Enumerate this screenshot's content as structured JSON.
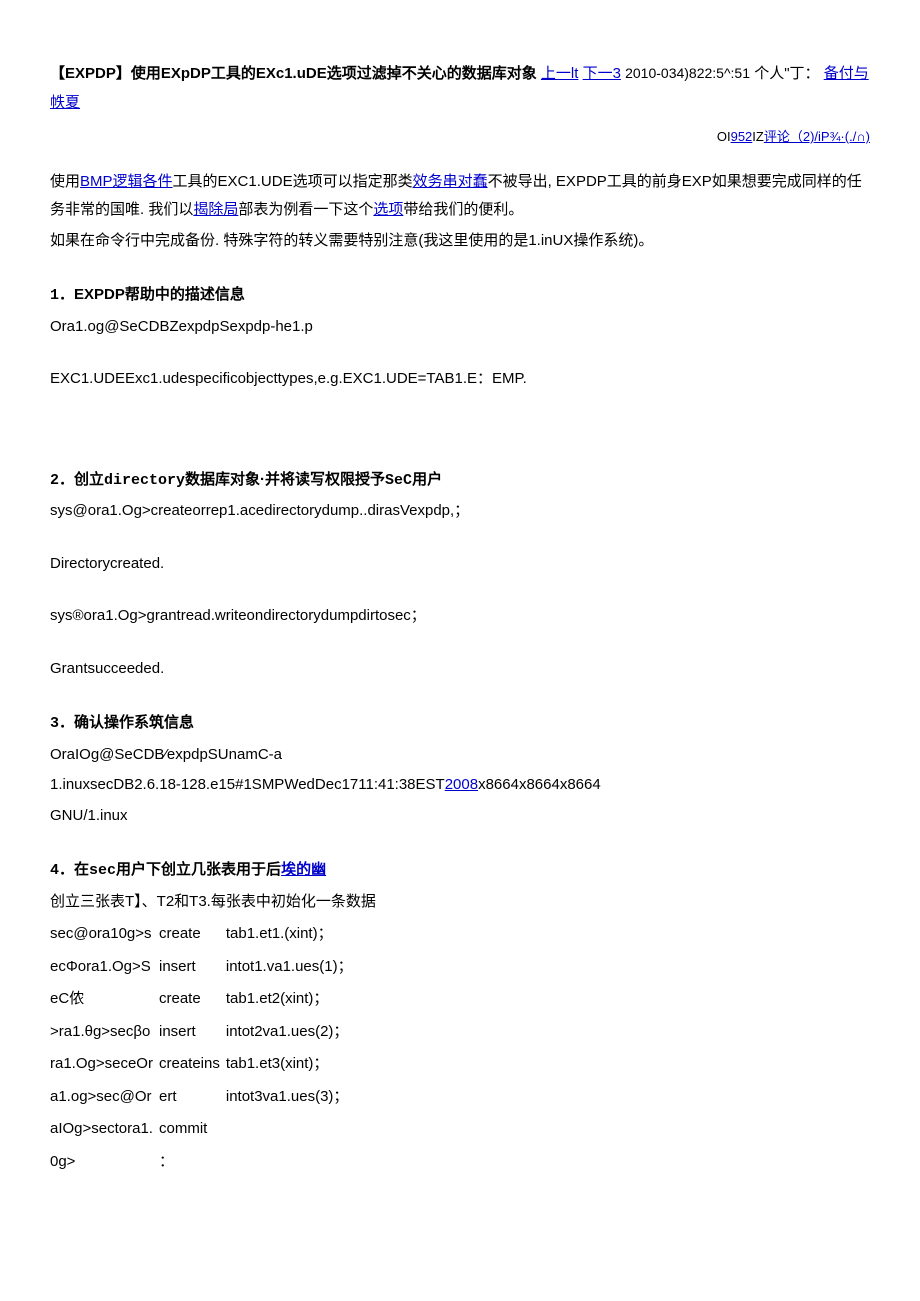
{
  "header": {
    "title_bold": "【EXPDP】使用EXpDP工具的EXc1.uDE选项过滤掉不关心的数据库对象",
    "nav_prev": "上一lt",
    "nav_next": "下一3",
    "timestamp": "2010-034)822:5^:51",
    "person": "个人\"丁：",
    "cat_link": "备付与帙夏"
  },
  "meta": {
    "m1": "OI",
    "m2": "952",
    "m3": "IZ",
    "m4": "评论（2)",
    "m5": "/iP¾·(./∩)"
  },
  "body": {
    "p1a": "使用",
    "p1_link1": "BMP",
    "p1_link2": "逻辑各件",
    "p1b": "工具的EXC1.UDE选项可以指定那类",
    "p1_link3": "效务串对蠢",
    "p1c": "不被导出, EXPDP工具的前身EXP如果想要完成同样的任务非常的国唯. 我们以",
    "p1_link4": "揭除局",
    "p1d": "部表为例看一下这个",
    "p1_link5": "选项",
    "p1e": "带给我们的便利。",
    "p2": "如果在命令行中完成备份. 特殊字符的转义需要特别注意(我这里使用的是1.inUX操作系统)。"
  },
  "s1": {
    "num": "1",
    "title": "．EXPDP帮助中的描述信息",
    "l1": "Ora1.og@SeCDBZexpdpSexpdp-he1.p",
    "l2": "EXC1.UDEExc1.udespecificobjecttypes,e.g.EXC1.UDE=TAB1.E：EMP."
  },
  "s2": {
    "num": "2",
    "title_a": "．创立",
    "title_mono": "directory",
    "title_b": "数据库对象·并将读写权限授予",
    "title_mono2": "SeC",
    "title_c": "用户",
    "l1": "sys@ora1.Og>createorrep1.acedirectorydump..dirasVexpdp,；",
    "l2": "Directorycreated.",
    "l3": "sys®ora1.Og>grantread.writeondirectorydumpdirtosec；",
    "l4": "Grantsucceeded."
  },
  "s3": {
    "num": "3",
    "title": "．确认操作系筑信息",
    "l1": "OraIOg@SeCDB⁄expdpSUnamC-a",
    "l2a": "1.inuxsecDB2.6.18-128.e15#1SMPWedDec1711:41:38EST",
    "l2_link": "2008",
    "l2b": "x8664x8664x8664",
    "l3": "GNU/1.inux"
  },
  "s4": {
    "num": "4",
    "title_a": "．在",
    "title_mono": "sec",
    "title_b": "用户下创立几张表用于后",
    "title_link": "埃的幽",
    "l1": "创立三张表T】、T2和T3.每张表中初始化一条数据",
    "tbl": [
      [
        "sec@ora10g>s",
        "create",
        "tab1.et1.(xint)；"
      ],
      [
        "ecΦora1.Og>S",
        "insert",
        "intot1.va1.ues(1)；"
      ],
      [
        "eC侬",
        "create",
        "tab1.et2(xint)；"
      ],
      [
        ">ra1.θg>secβo",
        "insert",
        "intot2va1.ues(2)；"
      ],
      [
        "ra1.Og>seceOr",
        "createins",
        "tab1.et3(xint)；"
      ],
      [
        "a1.og>sec@Or",
        "ert",
        "intot3va1.ues(3)；"
      ],
      [
        "aIOg>sectora1.",
        "commit",
        ""
      ],
      [
        "0g>",
        "：",
        ""
      ]
    ]
  }
}
